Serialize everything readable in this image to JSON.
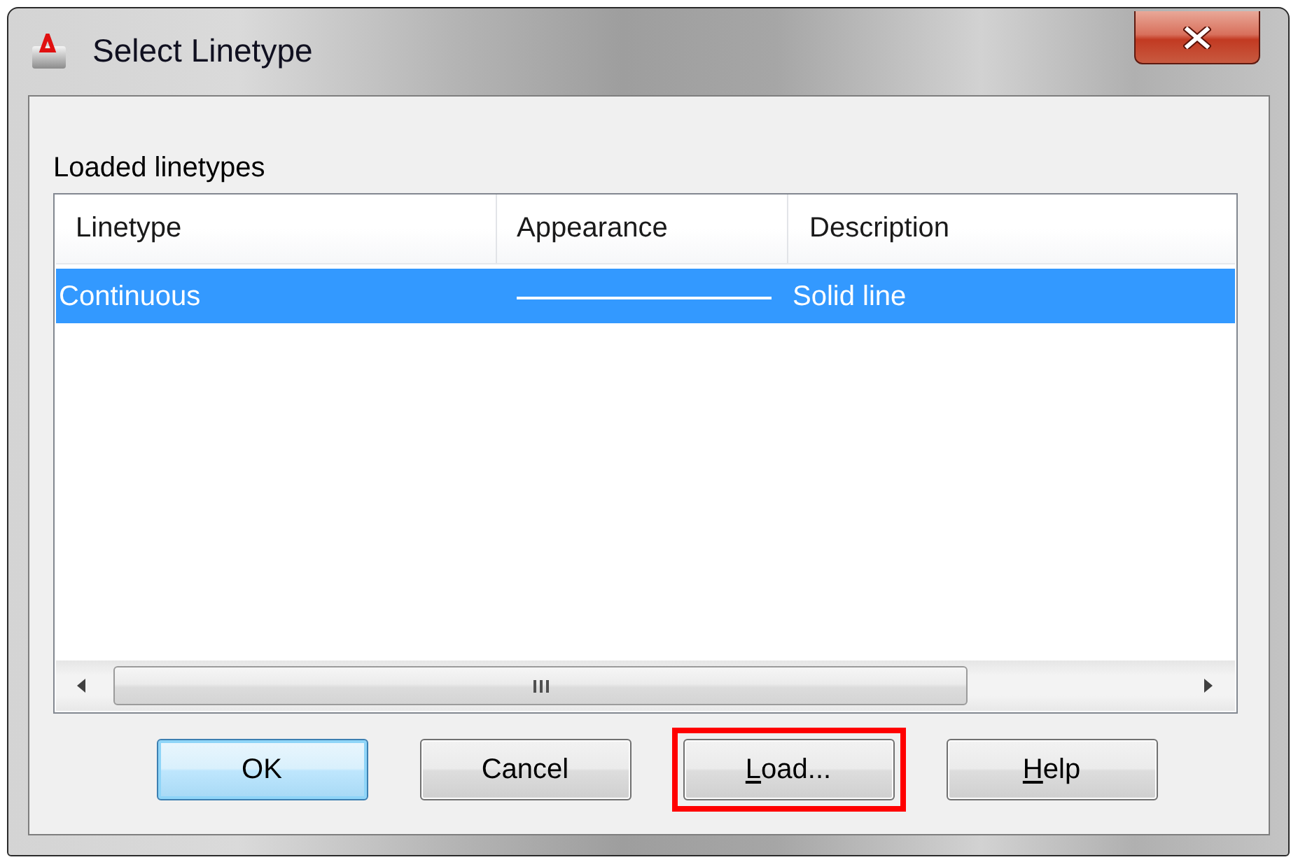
{
  "window": {
    "title": "Select Linetype"
  },
  "loaded_linetypes": {
    "label": "Loaded linetypes",
    "columns": [
      "Linetype",
      "Appearance",
      "Description"
    ],
    "rows": [
      {
        "linetype": "Continuous",
        "description": "Solid line",
        "selected": true
      }
    ]
  },
  "buttons": [
    {
      "label": "OK",
      "default": true,
      "underline_first": false,
      "highlighted": false
    },
    {
      "label": "Cancel",
      "default": false,
      "underline_first": false,
      "highlighted": false
    },
    {
      "label": "Load...",
      "default": false,
      "underline_first": true,
      "highlighted": true
    },
    {
      "label": "Help",
      "default": false,
      "underline_first": true,
      "highlighted": false
    }
  ]
}
